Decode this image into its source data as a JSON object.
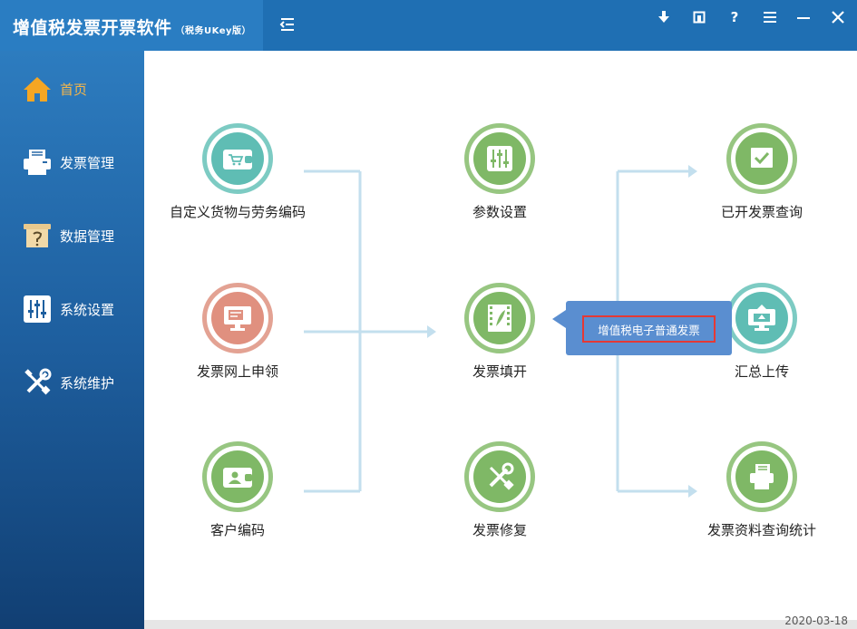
{
  "app": {
    "title": "增值税发票开票软件",
    "subtitle": "（税务UKey版）"
  },
  "window_controls": [
    {
      "name": "download-icon",
      "glyph": "⬇"
    },
    {
      "name": "restore-icon",
      "glyph": "◧"
    },
    {
      "name": "help-icon",
      "glyph": "?"
    },
    {
      "name": "menu-icon",
      "glyph": "≡"
    },
    {
      "name": "minimize-icon",
      "glyph": "—"
    },
    {
      "name": "close-icon",
      "glyph": "✕"
    }
  ],
  "sidebar": {
    "items": [
      {
        "label": "首页",
        "icon": "home-icon",
        "active": true
      },
      {
        "label": "发票管理",
        "icon": "invoice-printer-icon",
        "active": false
      },
      {
        "label": "数据管理",
        "icon": "data-management-icon",
        "active": false
      },
      {
        "label": "系统设置",
        "icon": "sliders-icon",
        "active": false
      },
      {
        "label": "系统维护",
        "icon": "tools-icon",
        "active": false
      }
    ]
  },
  "main": {
    "functions": {
      "custom_goods": {
        "label": "自定义货物与劳务编码",
        "icon": "wallet-cart-icon",
        "color": "teal"
      },
      "online_apply": {
        "label": "发票网上申领",
        "icon": "monitor-card-icon",
        "color": "pink"
      },
      "customer_code": {
        "label": "客户编码",
        "icon": "wallet-person-icon",
        "color": "green"
      },
      "params": {
        "label": "参数设置",
        "icon": "sliders-icon",
        "color": "green"
      },
      "issue": {
        "label": "发票填开",
        "icon": "feather-icon",
        "color": "green"
      },
      "repair": {
        "label": "发票修复",
        "icon": "wrench-screwdriver-icon",
        "color": "green"
      },
      "query_issued": {
        "label": "已开发票查询",
        "icon": "magnifier-check-icon",
        "color": "green"
      },
      "summary_upload": {
        "label": "汇总上传",
        "icon": "upload-monitor-icon",
        "color": "teal"
      },
      "stats": {
        "label": "发票资料查询统计",
        "icon": "magnifier-printer-icon",
        "color": "green"
      }
    },
    "popup": {
      "item_label": "增值税电子普通发票"
    }
  },
  "statusbar": {
    "date_partial": "2020-03-18"
  },
  "colors": {
    "titlebar": "#1f6fb3",
    "sidebar_active": "#f5b64a",
    "teal": "#7dcbc3",
    "green": "#97c681",
    "pink": "#e3a293",
    "flow_line": "#c3dfee",
    "popup_bg": "#5a8ed0",
    "popup_border": "#e53935"
  }
}
